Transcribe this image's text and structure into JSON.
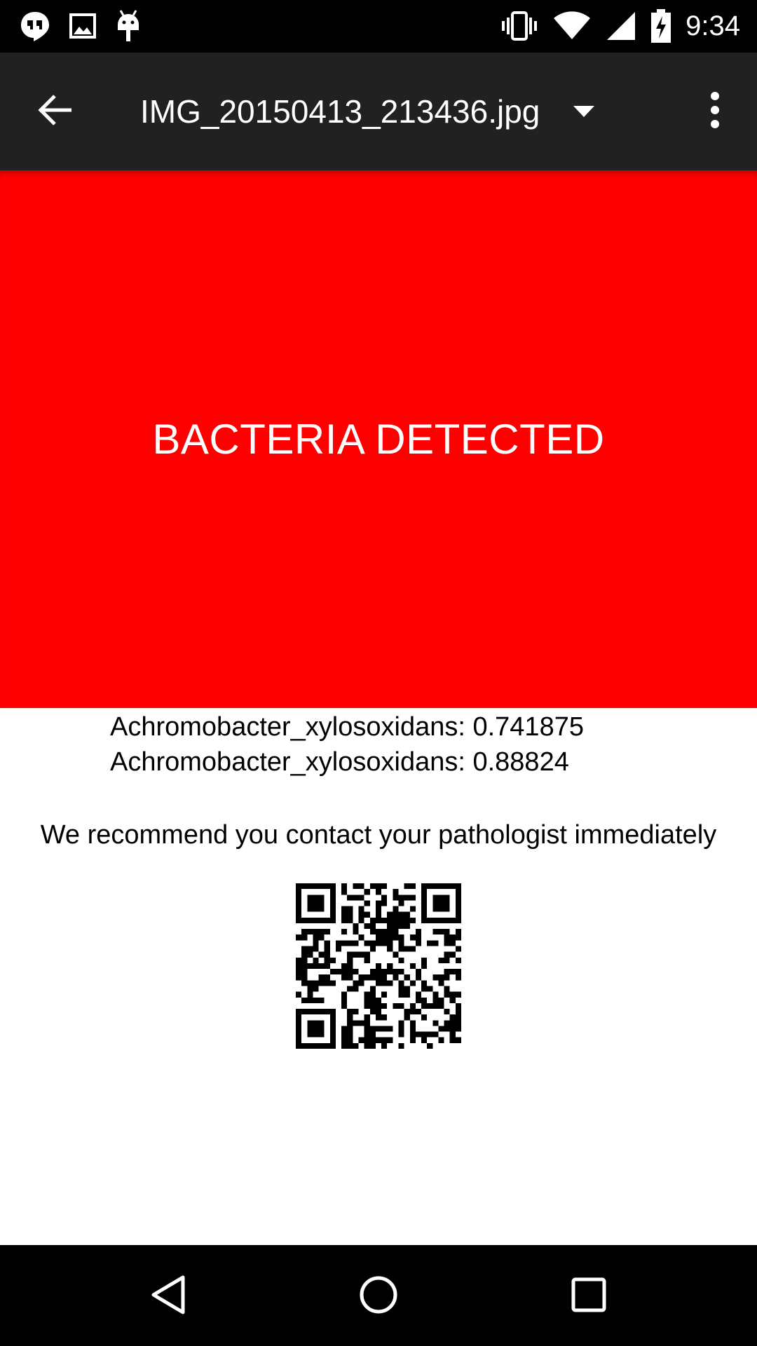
{
  "status_bar": {
    "time": "9:34",
    "left_icons": [
      "hangouts-icon",
      "gallery-icon",
      "android-debug-icon"
    ],
    "right_icons": [
      "vibrate-icon",
      "wifi-icon",
      "signal-icon",
      "battery-charging-icon"
    ]
  },
  "toolbar": {
    "title": "IMG_20150413_213436.jpg",
    "back_icon": "arrow-back-icon",
    "dropdown_icon": "dropdown-arrow-icon",
    "overflow_icon": "more-vert-icon"
  },
  "alert": {
    "text": "BACTERIA DETECTED",
    "background_color": "#ff0000",
    "text_color": "#ffffff"
  },
  "results": [
    "Achromobacter_xylosoxidans: 0.741875",
    "Achromobacter_xylosoxidans: 0.88824"
  ],
  "recommendation": "We recommend you contact your pathologist immediately",
  "qr_code": {
    "icon": "qr-code"
  },
  "nav_bar": {
    "buttons": [
      "back-triangle-icon",
      "home-circle-icon",
      "recents-square-icon"
    ]
  },
  "colors": {
    "status_bar": "#000000",
    "toolbar": "#212121",
    "nav_bar": "#000000"
  }
}
